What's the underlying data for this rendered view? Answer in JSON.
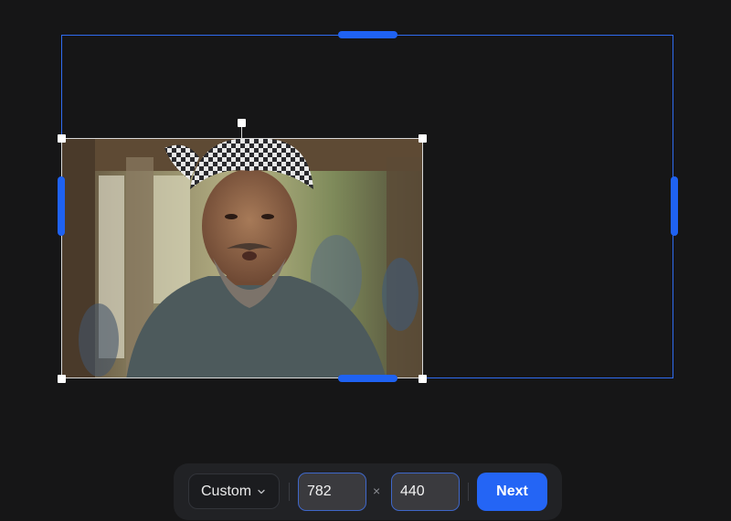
{
  "editor": {
    "canvas_color": "#2f6bf0",
    "image_description_icon": "photo-man-checkered-headscarf"
  },
  "toolbar": {
    "preset_label": "Custom",
    "width_value": "782",
    "height_value": "440",
    "times_symbol": "×",
    "next_label": "Next",
    "accent_color": "#2465f5"
  }
}
